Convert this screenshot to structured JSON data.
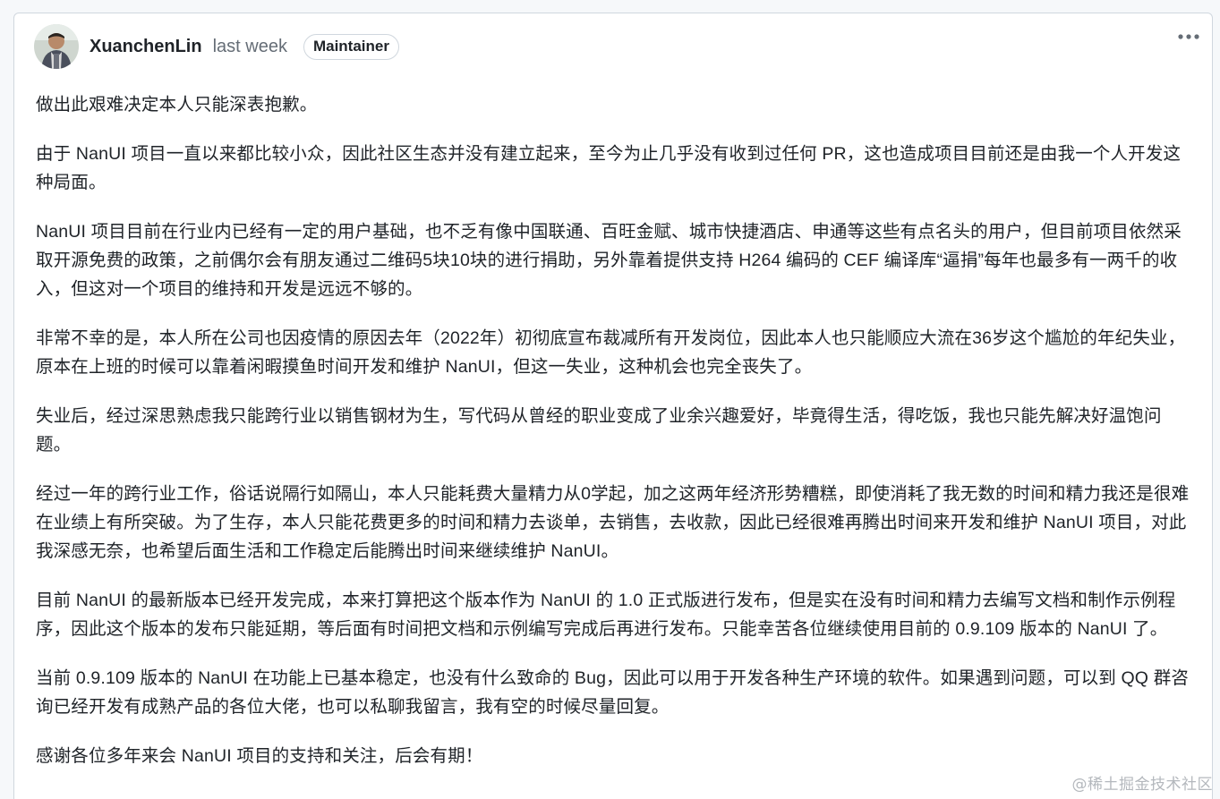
{
  "comment": {
    "author": "XuanchenLin",
    "timestamp": "last week",
    "role_badge": "Maintainer",
    "menu_icon": "kebab-horizontal-icon",
    "paragraphs": [
      "做出此艰难决定本人只能深表抱歉。",
      "由于 NanUI 项目一直以来都比较小众，因此社区生态并没有建立起来，至今为止几乎没有收到过任何 PR，这也造成项目目前还是由我一个人开发这种局面。",
      "NanUI 项目目前在行业内已经有一定的用户基础，也不乏有像中国联通、百旺金赋、城市快捷酒店、申通等这些有点名头的用户，但目前项目依然采取开源免费的政策，之前偶尔会有朋友通过二维码5块10块的进行捐助，另外靠着提供支持 H264 编码的 CEF 编译库“逼捐”每年也最多有一两千的收入，但这对一个项目的维持和开发是远远不够的。",
      "非常不幸的是，本人所在公司也因疫情的原因去年（2022年）初彻底宣布裁减所有开发岗位，因此本人也只能顺应大流在36岁这个尴尬的年纪失业，原本在上班的时候可以靠着闲暇摸鱼时间开发和维护 NanUI，但这一失业，这种机会也完全丧失了。",
      "失业后，经过深思熟虑我只能跨行业以销售钢材为生，写代码从曾经的职业变成了业余兴趣爱好，毕竟得生活，得吃饭，我也只能先解决好温饱问题。",
      "经过一年的跨行业工作，俗话说隔行如隔山，本人只能耗费大量精力从0学起，加之这两年经济形势糟糕，即使消耗了我无数的时间和精力我还是很难在业绩上有所突破。为了生存，本人只能花费更多的时间和精力去谈单，去销售，去收款，因此已经很难再腾出时间来开发和维护 NanUI 项目，对此我深感无奈，也希望后面生活和工作稳定后能腾出时间来继续维护 NanUI。",
      "目前 NanUI 的最新版本已经开发完成，本来打算把这个版本作为 NanUI 的 1.0 正式版进行发布，但是实在没有时间和精力去编写文档和制作示例程序，因此这个版本的发布只能延期，等后面有时间把文档和示例编写完成后再进行发布。只能幸苦各位继续使用目前的 0.9.109 版本的 NanUI 了。",
      "当前 0.9.109 版本的 NanUI 在功能上已基本稳定，也没有什么致命的 Bug，因此可以用于开发各种生产环境的软件。如果遇到问题，可以到 QQ 群咨询已经开发有成熟产品的各位大佬，也可以私聊我留言，我有空的时候尽量回复。",
      "感谢各位多年来会 NanUI 项目的支持和关注，后会有期！"
    ]
  },
  "watermark": "@稀土掘金技术社区"
}
